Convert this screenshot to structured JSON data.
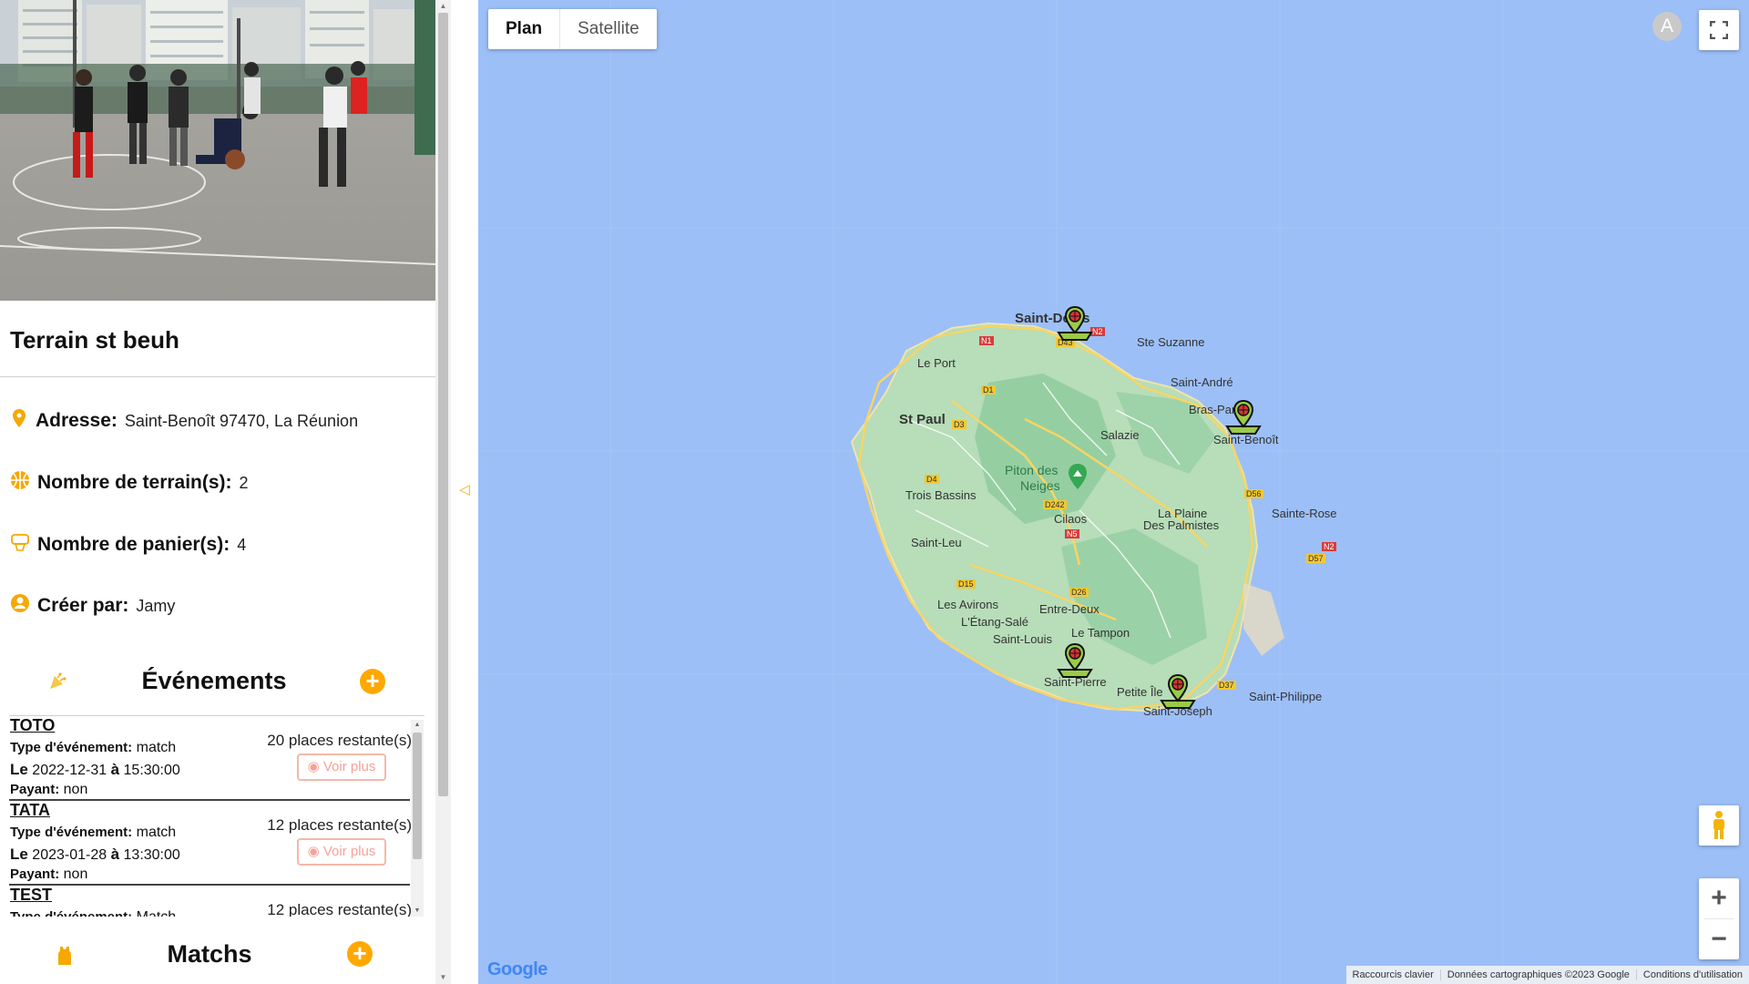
{
  "terrain": {
    "title": "Terrain st beuh",
    "address_label": "Adresse:",
    "address_value": "Saint-Benoît 97470, La Réunion",
    "courts_label": "Nombre de terrain(s):",
    "courts_value": "2",
    "baskets_label": "Nombre de panier(s):",
    "baskets_value": "4",
    "creator_label": "Créer par:",
    "creator_value": "Jamy"
  },
  "events_section": {
    "title": "Événements",
    "add_label": "+",
    "items": [
      {
        "name": "TOTO",
        "type_label": "Type d'événement:",
        "type_value": "match",
        "date_prefix": "Le",
        "date": "2022-12-31",
        "at": "à",
        "time": "15:30:00",
        "paid_label": "Payant:",
        "paid_value": "non",
        "places": "20 places restante(s)",
        "more": "Voir plus"
      },
      {
        "name": "TATA",
        "type_label": "Type d'événement:",
        "type_value": "match",
        "date_prefix": "Le",
        "date": "2023-01-28",
        "at": "à",
        "time": "13:30:00",
        "paid_label": "Payant:",
        "paid_value": "non",
        "places": "12 places restante(s)",
        "more": "Voir plus"
      },
      {
        "name": "TEST",
        "type_label": "Type d'événement:",
        "type_value": "Match",
        "places": "12 places restante(s)"
      }
    ]
  },
  "matchs_section": {
    "title": "Matchs",
    "add_label": "+"
  },
  "map": {
    "type_plan": "Plan",
    "type_satellite": "Satellite",
    "avatar_letter": "A",
    "zoom_in": "+",
    "zoom_out": "−",
    "google": "Google",
    "footer_shortcuts": "Raccourcis clavier",
    "footer_data": "Données cartographiques ©2023 Google",
    "footer_terms": "Conditions d'utilisation",
    "places": {
      "saint_denis": "Saint-Denis",
      "ste_suzanne": "Ste Suzanne",
      "le_port": "Le Port",
      "saint_andre": "Saint-André",
      "st_paul": "St Paul",
      "bras_panon": "Bras-Panon",
      "saint_benoit": "Saint-Benoît",
      "salazie": "Salazie",
      "piton_1": "Piton des",
      "piton_2": "Neiges",
      "trois_bassins": "Trois Bassins",
      "cilaos": "Cilaos",
      "plaine_1": "La Plaine",
      "plaine_2": "Des Palmistes",
      "sainte_rose": "Sainte-Rose",
      "saint_leu": "Saint-Leu",
      "les_avirons": "Les Avirons",
      "entre_deux": "Entre-Deux",
      "etang_sale": "L'Étang-Salé",
      "le_tampon": "Le Tampon",
      "saint_louis": "Saint-Louis",
      "saint_pierre": "Saint-Pierre",
      "petite_ile": "Petite Île",
      "saint_joseph": "Saint-Joseph",
      "saint_philippe": "Saint-Philippe"
    },
    "roads": {
      "n1": "N1",
      "n2": "N2",
      "d43": "D43",
      "d1": "D1",
      "d3": "D3",
      "d4": "D4",
      "d242": "D242",
      "n5": "N5",
      "d15": "D15",
      "d26": "D26",
      "d56": "D56",
      "n2b": "N2",
      "d57": "D57",
      "d37": "D37"
    }
  }
}
